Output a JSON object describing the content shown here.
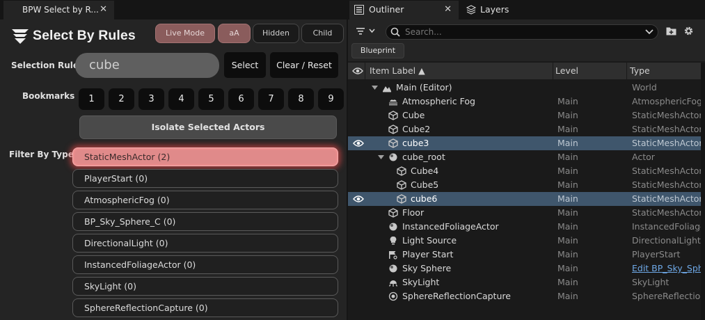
{
  "left": {
    "tab_title": "BPW Select by R...",
    "tab_close": "✕",
    "logo_text": "Select By Rules",
    "toggles": [
      {
        "label": "Live Mode",
        "on": true
      },
      {
        "label": "aA",
        "on": true
      },
      {
        "label": "Hidden",
        "on": false
      },
      {
        "label": "Child",
        "on": false
      }
    ],
    "selection_rule_label": "Selection Rule",
    "rule_value": "cube",
    "select_label": "Select",
    "clear_label": "Clear / Reset",
    "bookmarks_label": "Bookmarks",
    "bookmarks": [
      "1",
      "2",
      "3",
      "4",
      "5",
      "6",
      "7",
      "8",
      "9"
    ],
    "isolate_label": "Isolate Selected Actors",
    "filter_label": "Filter By Types",
    "filters": [
      "StaticMeshActor  (2)",
      "PlayerStart  (0)",
      "AtmosphericFog  (0)",
      "BP_Sky_Sphere_C  (0)",
      "DirectionalLight  (0)",
      "InstancedFoliageActor  (0)",
      "SkyLight  (0)",
      "SphereReflectionCapture  (0)"
    ]
  },
  "right": {
    "tabs": [
      {
        "label": "Outliner",
        "close": "✕"
      },
      {
        "label": "Layers"
      }
    ],
    "search_placeholder": "Search...",
    "blueprint_label": "Blueprint",
    "columns": {
      "item": "Item Label ▲",
      "level": "Level",
      "type": "Type"
    },
    "rows": [
      {
        "name": "Main (Editor)",
        "level": "",
        "type": "World",
        "indent": 0,
        "icon": "world-icon",
        "sel": false,
        "eye": false
      },
      {
        "name": "Atmospheric Fog",
        "level": "Main",
        "type": "AtmosphericFog",
        "indent": 1,
        "icon": "fog-icon",
        "sel": false,
        "eye": false
      },
      {
        "name": "Cube",
        "level": "Main",
        "type": "StaticMeshActor",
        "indent": 1,
        "icon": "static-mesh-icon",
        "sel": false,
        "eye": false
      },
      {
        "name": "Cube2",
        "level": "Main",
        "type": "StaticMeshActor",
        "indent": 1,
        "icon": "static-mesh-icon",
        "sel": false,
        "eye": false
      },
      {
        "name": "cube3",
        "level": "Main",
        "type": "StaticMeshActor",
        "indent": 1,
        "icon": "static-mesh-icon",
        "sel": true,
        "eye": true
      },
      {
        "name": "cube_root",
        "level": "Main",
        "type": "Actor",
        "indent": 1,
        "icon": "actor-icon",
        "sel": false,
        "eye": false
      },
      {
        "name": "Cube4",
        "level": "Main",
        "type": "StaticMeshActor",
        "indent": 2,
        "icon": "static-mesh-icon",
        "sel": false,
        "eye": false
      },
      {
        "name": "Cube5",
        "level": "Main",
        "type": "StaticMeshActor",
        "indent": 2,
        "icon": "static-mesh-icon",
        "sel": false,
        "eye": false
      },
      {
        "name": "cube6",
        "level": "Main",
        "type": "StaticMeshActor",
        "indent": 2,
        "icon": "static-mesh-icon",
        "sel": true,
        "eye": true
      },
      {
        "name": "Floor",
        "level": "Main",
        "type": "StaticMeshActor",
        "indent": 1,
        "icon": "static-mesh-icon",
        "sel": false,
        "eye": false
      },
      {
        "name": "InstancedFoliageActor",
        "level": "Main",
        "type": "InstancedFoliage",
        "indent": 1,
        "icon": "actor-icon",
        "sel": false,
        "eye": false
      },
      {
        "name": "Light Source",
        "level": "Main",
        "type": "DirectionalLight",
        "indent": 1,
        "icon": "light-icon",
        "sel": false,
        "eye": false
      },
      {
        "name": "Player Start",
        "level": "Main",
        "type": "PlayerStart",
        "indent": 1,
        "icon": "player-start-icon",
        "sel": false,
        "eye": false
      },
      {
        "name": "Sky Sphere",
        "level": "Main",
        "type": "Edit BP_Sky_Sph",
        "indent": 1,
        "icon": "actor-icon",
        "sel": false,
        "eye": false,
        "link": true
      },
      {
        "name": "SkyLight",
        "level": "Main",
        "type": "SkyLight",
        "indent": 1,
        "icon": "skylight-icon",
        "sel": false,
        "eye": false
      },
      {
        "name": "SphereReflectionCapture",
        "level": "Main",
        "type": "SphereReflection",
        "indent": 1,
        "icon": "reflection-icon",
        "sel": false,
        "eye": false
      }
    ]
  }
}
